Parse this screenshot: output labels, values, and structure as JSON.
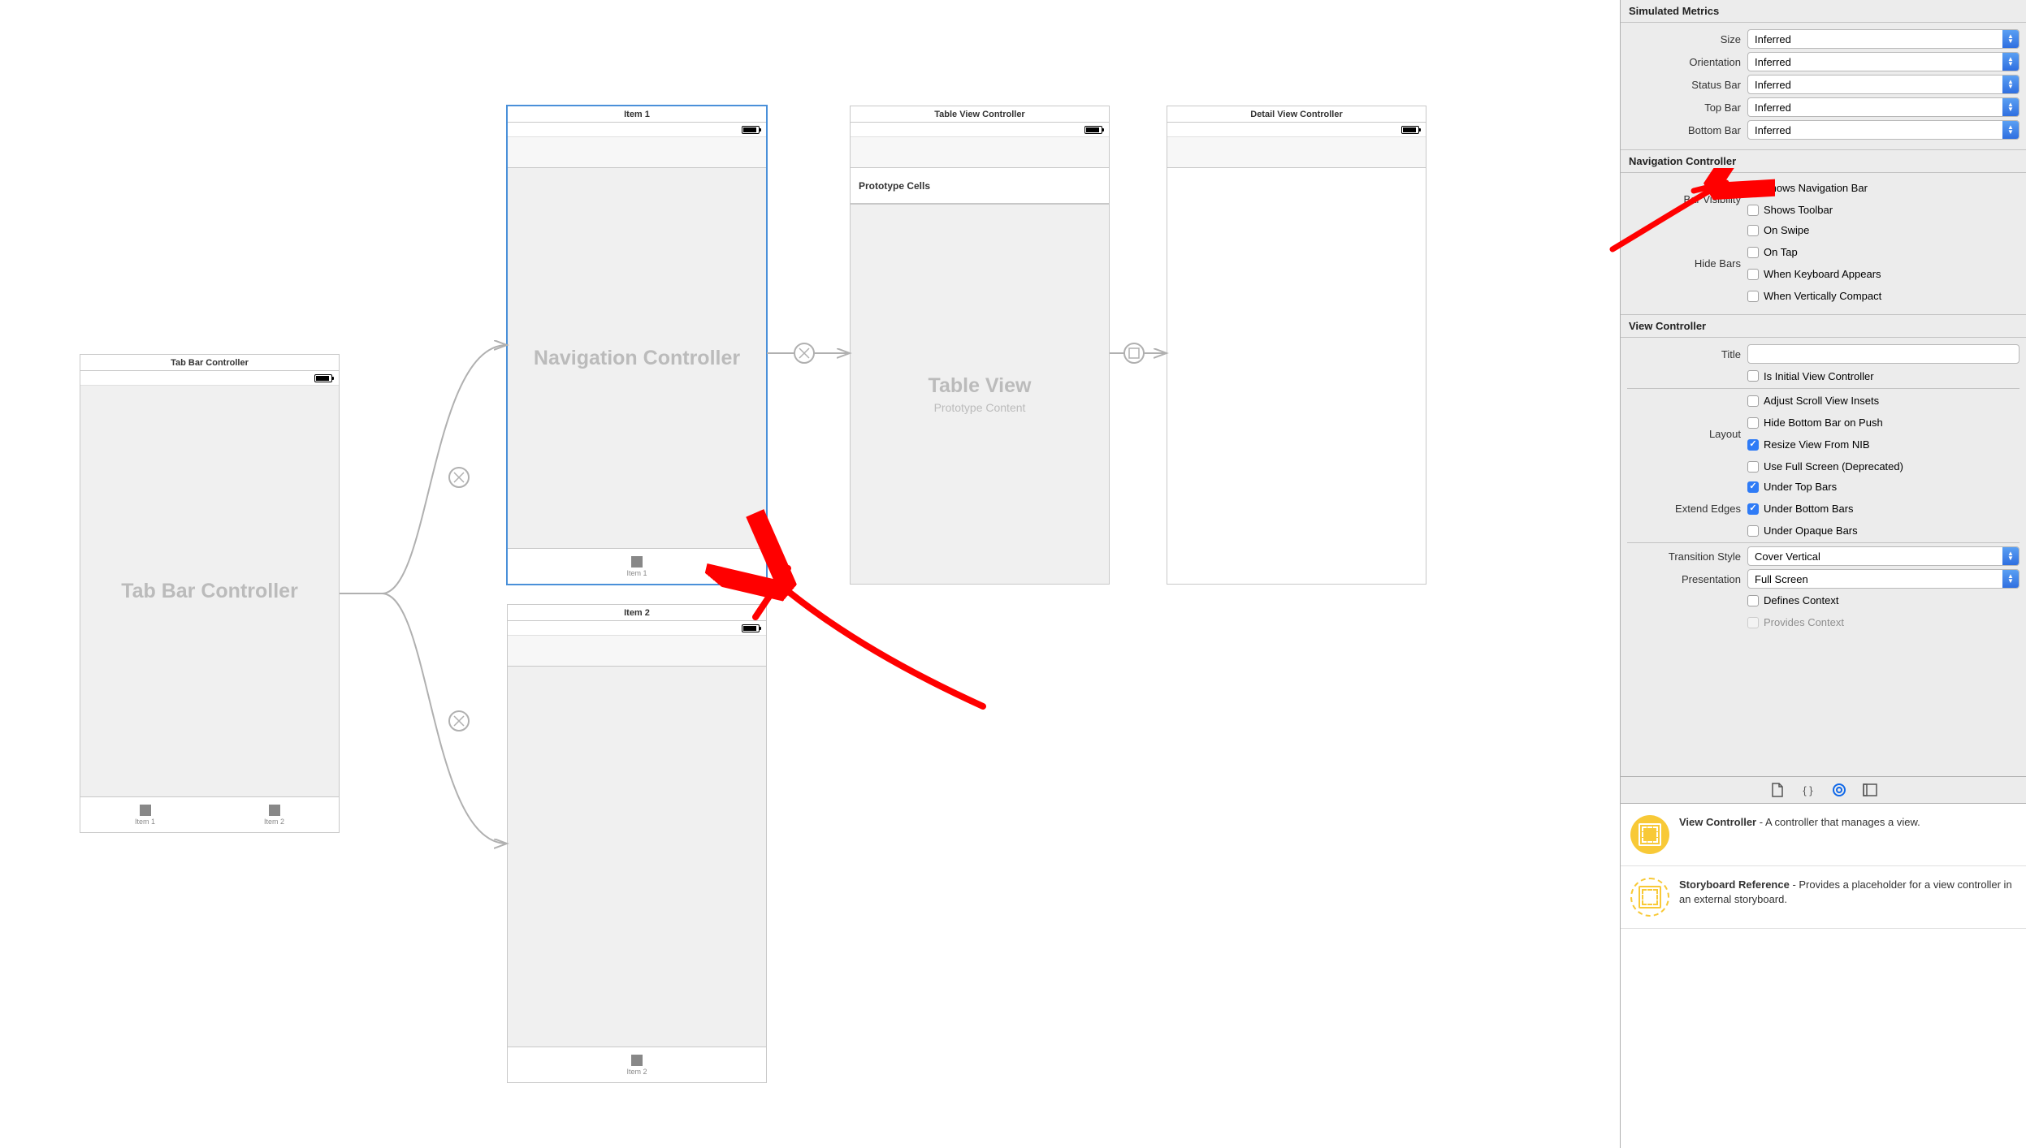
{
  "canvas": {
    "scenes": {
      "tabbar": {
        "title": "Tab Bar Controller",
        "body_big": "Tab Bar Controller",
        "tab1": "Item 1",
        "tab2": "Item 2"
      },
      "nav1": {
        "title": "Item 1",
        "body_big": "Navigation Controller",
        "tab": "Item 1"
      },
      "nav2": {
        "title": "Item 2",
        "tab": "Item 2"
      },
      "table": {
        "title": "Table View Controller",
        "proto": "Prototype Cells",
        "body_big": "Table View",
        "body_small": "Prototype Content"
      },
      "detail": {
        "title": "Detail View Controller"
      }
    }
  },
  "inspector": {
    "simulated": {
      "header": "Simulated Metrics",
      "size_label": "Size",
      "size_value": "Inferred",
      "orientation_label": "Orientation",
      "orientation_value": "Inferred",
      "statusbar_label": "Status Bar",
      "statusbar_value": "Inferred",
      "topbar_label": "Top Bar",
      "topbar_value": "Inferred",
      "bottombar_label": "Bottom Bar",
      "bottombar_value": "Inferred"
    },
    "navcontroller": {
      "header": "Navigation Controller",
      "barvis_label": "Bar Visibility",
      "shows_nav": "Shows Navigation Bar",
      "shows_toolbar": "Shows Toolbar",
      "hidebars_label": "Hide Bars",
      "on_swipe": "On Swipe",
      "on_tap": "On Tap",
      "when_kbd": "When Keyboard Appears",
      "when_vcompact": "When Vertically Compact"
    },
    "viewcontroller": {
      "header": "View Controller",
      "title_label": "Title",
      "title_value": "",
      "is_initial": "Is Initial View Controller",
      "layout_label": "Layout",
      "adjust_scroll": "Adjust Scroll View Insets",
      "hide_bottom_push": "Hide Bottom Bar on Push",
      "resize_nib": "Resize View From NIB",
      "full_screen_dep": "Use Full Screen (Deprecated)",
      "extend_label": "Extend Edges",
      "under_top": "Under Top Bars",
      "under_bottom": "Under Bottom Bars",
      "under_opaque": "Under Opaque Bars",
      "transition_label": "Transition Style",
      "transition_value": "Cover Vertical",
      "presentation_label": "Presentation",
      "presentation_value": "Full Screen",
      "defines_context": "Defines Context",
      "provides_context": "Provides Context"
    },
    "library": {
      "vc_title": "View Controller",
      "vc_desc": " - A controller that manages a view.",
      "sref_title": "Storyboard Reference",
      "sref_desc": " - Provides a placeholder for a view controller in an external storyboard."
    }
  }
}
